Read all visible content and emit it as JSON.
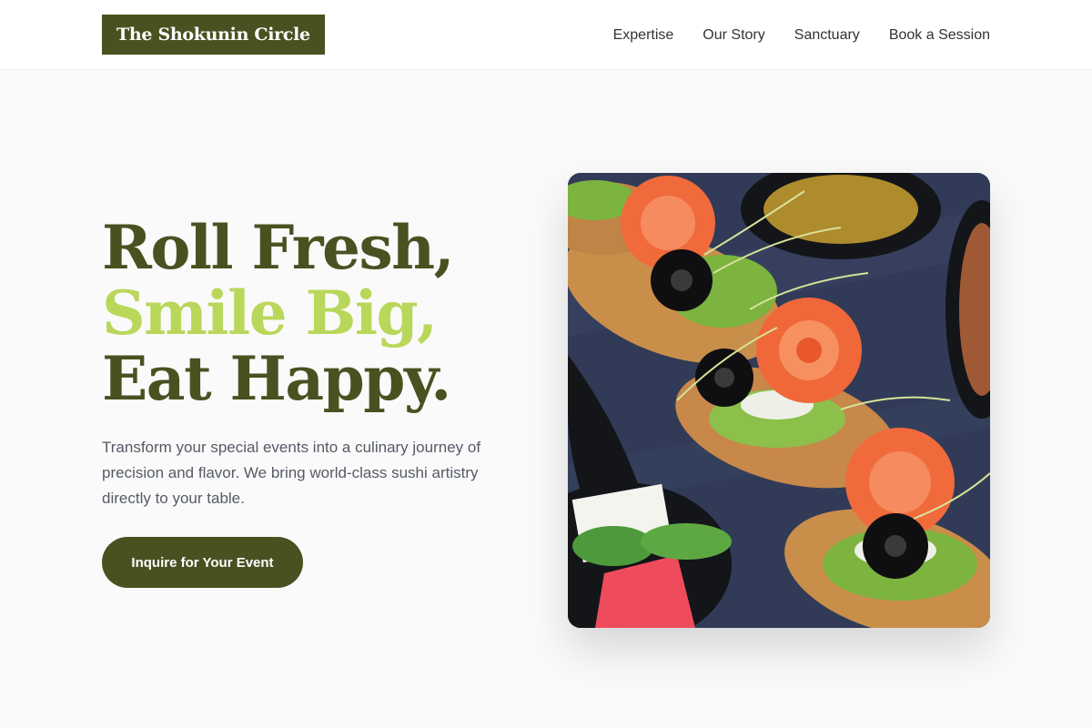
{
  "brand": {
    "name": "The Shokunin Circle"
  },
  "nav": {
    "items": [
      {
        "label": "Expertise"
      },
      {
        "label": "Our Story"
      },
      {
        "label": "Sanctuary"
      },
      {
        "label": "Book a Session"
      }
    ]
  },
  "hero": {
    "headline": [
      "Roll Fresh,",
      "Smile Big,",
      "Eat Happy."
    ],
    "description": "Transform your special events into a culinary journey of precision and flavor. We bring world-class sushi artistry directly to your table.",
    "cta_label": "Inquire for Your Event",
    "image": {
      "subject": "salmon-canape-platter-photo"
    }
  },
  "colors": {
    "brand": "#4a5121",
    "accent": "#b9d75a",
    "body_text": "#555b66"
  }
}
